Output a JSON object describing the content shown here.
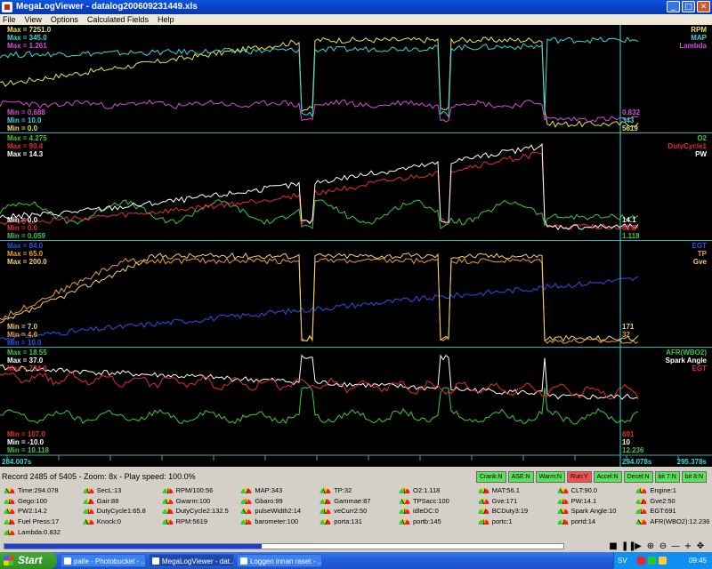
{
  "window": {
    "title": "MegaLogViewer - datalog200609231449.xls"
  },
  "menu": [
    "File",
    "View",
    "Options",
    "Calculated Fields",
    "Help"
  ],
  "panels": [
    {
      "labels": [
        {
          "text": "Max = 7251.0",
          "color": "#e6e65a"
        },
        {
          "text": "Max = 345.0",
          "color": "#3ad8d8"
        },
        {
          "text": "Max = 1.261",
          "color": "#d050d0"
        }
      ],
      "min_labels": [
        {
          "text": "Min = 0.688",
          "color": "#d050d0"
        },
        {
          "text": "Min = 10.0",
          "color": "#3ad8d8"
        },
        {
          "text": "Min = 0.0",
          "color": "#e6e65a"
        }
      ],
      "legend": [
        {
          "text": "RPM",
          "color": "#e6e65a"
        },
        {
          "text": "MAP",
          "color": "#3ad8d8"
        },
        {
          "text": "Lambda",
          "color": "#d050d0"
        }
      ],
      "cursor_values": [
        {
          "text": "0.832",
          "color": "#d050d0"
        },
        {
          "text": "343",
          "color": "#3ad8d8"
        },
        {
          "text": "5619",
          "color": "#e6e65a"
        }
      ]
    },
    {
      "labels": [
        {
          "text": "Max = 4.275",
          "color": "#40c840"
        },
        {
          "text": "Max = 90.4",
          "color": "#e03030"
        },
        {
          "text": "Max = 14.3",
          "color": "#ffffff"
        }
      ],
      "min_labels": [
        {
          "text": "Min = 0.0",
          "color": "#ffffff"
        },
        {
          "text": "Min = 0.0",
          "color": "#e03030"
        },
        {
          "text": "Min = 0.059",
          "color": "#40c840"
        }
      ],
      "legend": [
        {
          "text": "O2",
          "color": "#40c840"
        },
        {
          "text": "DutyCycle1",
          "color": "#e03030"
        },
        {
          "text": "PW",
          "color": "#ffffff"
        }
      ],
      "cursor_values": [
        {
          "text": "14.1",
          "color": "#ffffff"
        },
        {
          "text": "65.8",
          "color": "#e03030"
        },
        {
          "text": "1.118",
          "color": "#40c840"
        }
      ]
    },
    {
      "labels": [
        {
          "text": "Max = 84.0",
          "color": "#3050e8"
        },
        {
          "text": "Max = 65.0",
          "color": "#f0a030"
        },
        {
          "text": "Max = 200.0",
          "color": "#f0d070"
        }
      ],
      "min_labels": [
        {
          "text": "Min = 7.0",
          "color": "#f0d070"
        },
        {
          "text": "Min = 4.0",
          "color": "#f0a030"
        },
        {
          "text": "Min = 10.0",
          "color": "#3050e8"
        }
      ],
      "legend": [
        {
          "text": "EGT",
          "color": "#3050e8"
        },
        {
          "text": "TP",
          "color": "#f0a030"
        },
        {
          "text": "Gve",
          "color": "#f0d070"
        }
      ],
      "cursor_values": [
        {
          "text": "171",
          "color": "#f0d070"
        },
        {
          "text": "32",
          "color": "#f0a030"
        },
        {
          "text": "",
          "color": "#3050e8"
        }
      ]
    },
    {
      "labels": [
        {
          "text": "Max = 18.55",
          "color": "#40c840"
        },
        {
          "text": "Max = 37.0",
          "color": "#ffffff"
        },
        {
          "text": "Max = 734.0",
          "color": "#e03030"
        }
      ],
      "min_labels": [
        {
          "text": "Min = 107.0",
          "color": "#e03030"
        },
        {
          "text": "Min = -10.0",
          "color": "#ffffff"
        },
        {
          "text": "Min = 10.118",
          "color": "#40c840"
        }
      ],
      "legend": [
        {
          "text": "AFR(WBO2)",
          "color": "#40c840"
        },
        {
          "text": "Spark Angle",
          "color": "#ffffff"
        },
        {
          "text": "EGT",
          "color": "#e03030"
        }
      ],
      "cursor_values": [
        {
          "text": "691",
          "color": "#e03030"
        },
        {
          "text": "10",
          "color": "#ffffff"
        },
        {
          "text": "12.236",
          "color": "#40c840"
        }
      ]
    }
  ],
  "time_axis": {
    "left": "284.007s",
    "cursor": "294.078s",
    "right": "295.378s"
  },
  "status": {
    "record_info": "Record 2485 of 5405 - Zoom: 8x - Play speed: 100.0%"
  },
  "flags": [
    {
      "text": "Crank:N",
      "color": "#5ce05c"
    },
    {
      "text": "ASE:N",
      "color": "#5ce05c"
    },
    {
      "text": "Warm:N",
      "color": "#5ce05c"
    },
    {
      "text": "Run:Y",
      "color": "#f05050"
    },
    {
      "text": "Accel:N",
      "color": "#5ce05c"
    },
    {
      "text": "Decel:N",
      "color": "#5ce05c"
    },
    {
      "text": "bit 7:N",
      "color": "#5ce05c"
    },
    {
      "text": "bit 8:N",
      "color": "#5ce05c"
    }
  ],
  "gauges": [
    "Time:294.078",
    "SecL:13",
    "RPM/100:56",
    "MAP:343",
    "TP:32",
    "O2:1.118",
    "MAT:56.1",
    "CLT:90.0",
    "Engine:1",
    "Gego:100",
    "Gair:88",
    "Gwarm:100",
    "Gbaro:99",
    "Gammae:87",
    "TPSacc:100",
    "Gve:171",
    "PW:14.1",
    "Gve2:50",
    "PW2:14.2",
    "DutyCycle1:65.8",
    "DutyCycle2:132.5",
    "pulseWidth2:14",
    "veCurr2:50",
    "idleDC:0",
    "BCDuty3:19",
    "Spark Angle:10",
    "EGT:691",
    "Fuel Press:17",
    "Knock:0",
    "RPM:5619",
    "barometer:100",
    "porta:131",
    "portb:145",
    "portc:1",
    "portd:14",
    "AFR(WBO2):12.236",
    "Lambda:0.832"
  ],
  "playback": {
    "buttons": [
      "stop",
      "pause",
      "play",
      "zoom-in",
      "zoom-out",
      "minus",
      "plus",
      "expand"
    ],
    "glyphs": [
      "■",
      "❚❚",
      "▶",
      "⊕",
      "⊖",
      "—",
      "+",
      "✥"
    ],
    "progress": 0.46
  },
  "taskbar": {
    "start_label": "Start",
    "tasks": [
      "palle - Photobucket - ...",
      "MegaLogViewer - dat...",
      "Loggen innan raset - ..."
    ],
    "lang": "SV",
    "clock": "09:45"
  }
}
